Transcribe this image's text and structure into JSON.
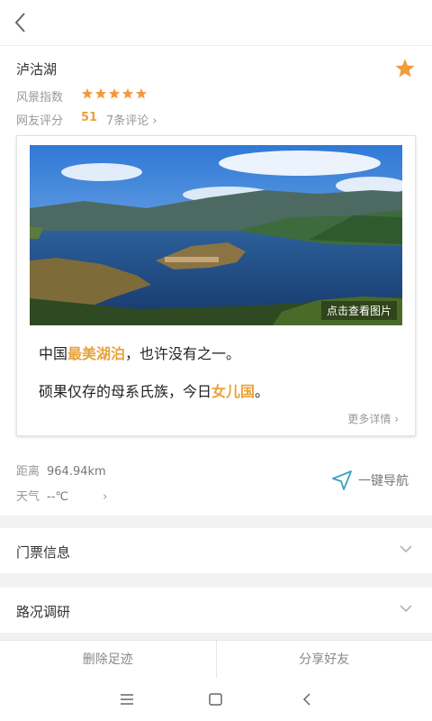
{
  "header": {
    "back_icon": "back-icon"
  },
  "place": {
    "name": "泸沽湖",
    "scenery_label": "风景指数",
    "scenery_stars": 5,
    "rating_label": "网友评分",
    "rating": "51",
    "reviews": "7条评论",
    "favorite_icon": "star-icon",
    "star_color": "#f39a3c"
  },
  "card": {
    "photo_caption": "点击查看图片",
    "line1": {
      "pre": "中国",
      "highlight": "最美湖泊",
      "post": "，也许没有之一。"
    },
    "line2": {
      "pre": "硕果仅存的母系氏族，今日",
      "highlight": "女儿国",
      "post": "。"
    },
    "more": "更多详情",
    "highlight_color": "#e8a33a"
  },
  "info": {
    "distance_label": "距离",
    "distance": "964.94km",
    "weather_label": "天气",
    "weather": "--℃",
    "nav_label": "一键导航",
    "nav_icon": "navigation-arrow-icon"
  },
  "sections": [
    {
      "label": "门票信息"
    },
    {
      "label": "路况调研"
    }
  ],
  "actions": {
    "delete": "删除足迹",
    "share": "分享好友"
  },
  "system_nav": [
    "menu-icon",
    "home-icon",
    "back-icon"
  ]
}
